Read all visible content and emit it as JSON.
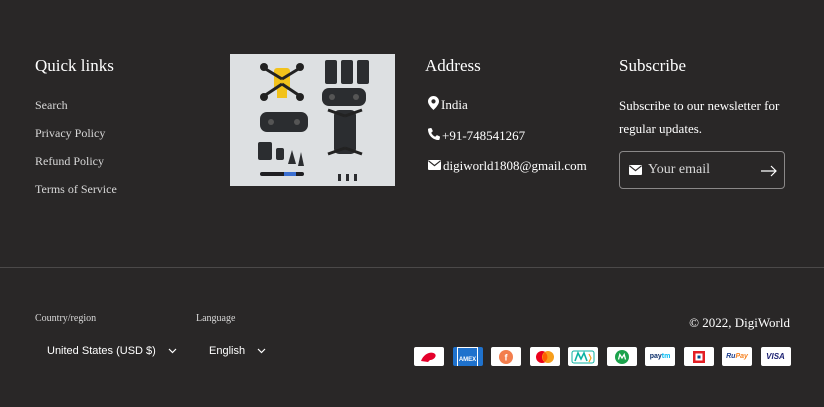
{
  "quick_links": {
    "title": "Quick links",
    "items": [
      "Search",
      "Privacy Policy",
      "Refund Policy",
      "Terms of Service"
    ]
  },
  "image": {
    "alt": "Drone kit flat lay"
  },
  "address": {
    "title": "Address",
    "location": "India",
    "phone": "+91-748541267",
    "email": "digiworld1808@gmail.com"
  },
  "subscribe": {
    "title": "Subscribe",
    "text": "Subscribe to our newsletter for regular updates.",
    "placeholder": "Your email"
  },
  "country": {
    "label": "Country/region",
    "value": "United States (USD $)"
  },
  "language": {
    "label": "Language",
    "value": "English"
  },
  "copyright": "© 2022, DigiWorld",
  "payments": [
    "airtel",
    "amex",
    "freecharge",
    "mastercard",
    "mobikwik",
    "mobikwik-m",
    "paytm",
    "hdfc",
    "rupay",
    "visa"
  ],
  "colors": {
    "background": "#292727",
    "text": "#ffffff",
    "muted": "#d8d8d8"
  }
}
